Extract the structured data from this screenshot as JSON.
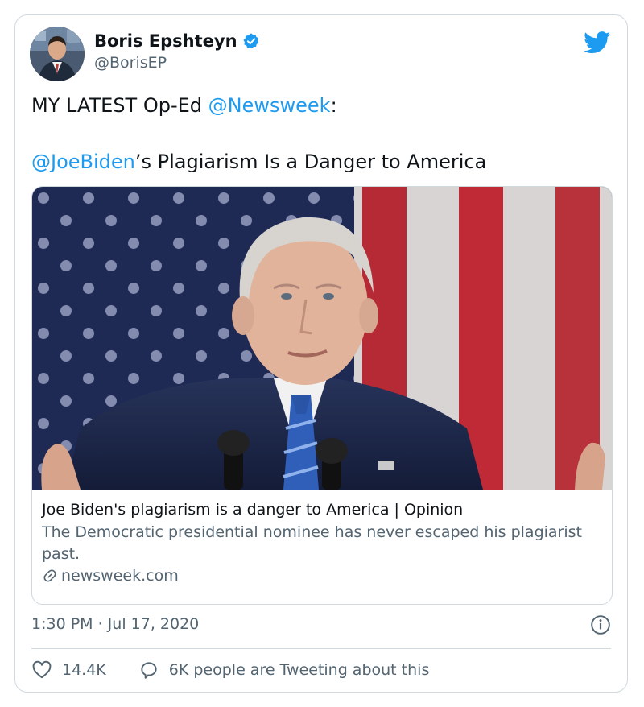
{
  "author": {
    "display_name": "Boris Epshteyn",
    "handle": "@BorisEP",
    "verified": true
  },
  "tweet": {
    "line1_prefix": "MY LATEST Op-Ed ",
    "line1_mention": "@Newsweek",
    "line1_suffix": ":",
    "line2_mention": "@JoeBiden",
    "line2_suffix": "’s Plagiarism Is a Danger to America"
  },
  "link_card": {
    "title": "Joe Biden's plagiarism is a danger to America | Opinion",
    "description": "The Democratic presidential nominee has never escaped his plagiarist past.",
    "domain": "newsweek.com"
  },
  "timestamp": "1:30 PM · Jul 17, 2020",
  "stats": {
    "likes": "14.4K",
    "conversation": "6K people are Tweeting about this"
  },
  "colors": {
    "link": "#1d9bf0",
    "secondary_text": "#536471",
    "border": "#cfd9de",
    "twitter_blue": "#1d9bf0"
  },
  "icons": [
    "verified-badge-icon",
    "twitter-bird-icon",
    "link-icon",
    "info-icon",
    "heart-icon",
    "speech-bubble-icon"
  ]
}
